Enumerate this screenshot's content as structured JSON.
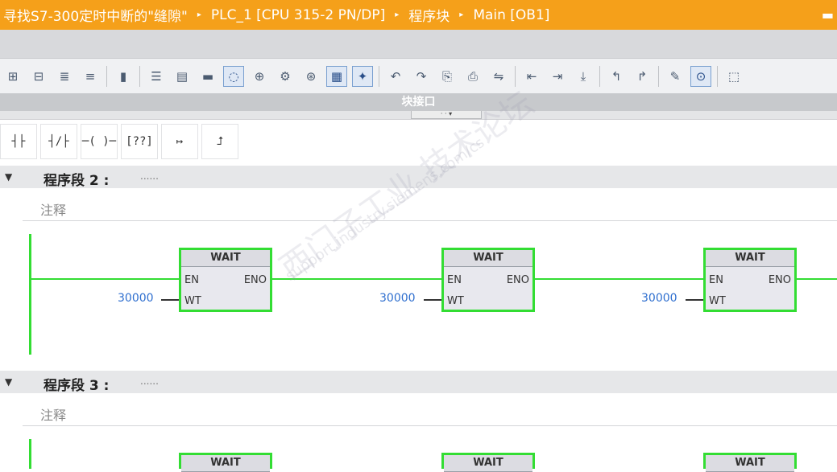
{
  "breadcrumb": {
    "items": [
      "寻找S7-300定时中断的\"缝隙\"",
      "PLC_1 [CPU 315-2 PN/DP]",
      "程序块",
      "Main [OB1]"
    ],
    "separator": "▸",
    "minimize": "▬"
  },
  "toolbar": {
    "buttons": [
      "insert-network-icon",
      "delete-network-icon",
      "insert-row-icon",
      "add-row-icon",
      "jump-icon",
      "ladder-view-icon",
      "fbd-view-icon",
      "stl-view-icon",
      "comment-toggle-icon",
      "absolute-operands-icon",
      "favorites-icon",
      "symbol-info-icon",
      "network-comments-icon",
      "bookmark-icon",
      "goto-prev-icon",
      "goto-next-icon",
      "call-hierarchy-icon",
      "monitor-icon",
      "compare-icon",
      "download-icon",
      "upload-icon",
      "open-block-icon",
      "close-block-icon",
      "parameter-icon",
      "monitoring-icon",
      "memory-icon"
    ]
  },
  "block_interface": {
    "label": "块接口"
  },
  "ladder_palette": {
    "items": [
      "┤├",
      "┤/├",
      "─( )─",
      "[??]",
      "↦",
      "⮥"
    ]
  },
  "networks": [
    {
      "title": "程序段 2 :",
      "dots": "......",
      "comment": "注释",
      "blocks": [
        {
          "name": "WAIT",
          "en": "EN",
          "eno": "ENO",
          "wt": "WT",
          "param": "30000"
        },
        {
          "name": "WAIT",
          "en": "EN",
          "eno": "ENO",
          "wt": "WT",
          "param": "30000"
        },
        {
          "name": "WAIT",
          "en": "EN",
          "eno": "ENO",
          "wt": "WT",
          "param": "30000"
        }
      ]
    },
    {
      "title": "程序段 3 :",
      "dots": "......",
      "comment": "注释",
      "blocks": [
        {
          "name": "WAIT"
        },
        {
          "name": "WAIT"
        },
        {
          "name": "WAIT"
        }
      ]
    }
  ],
  "watermark": {
    "cn": "西门子工业 技术论坛",
    "url": "support.industry.siemens.com/cs"
  },
  "colors": {
    "title_bar": "#f5a01a",
    "energized": "#33dd33",
    "param": "#2f6fcf"
  }
}
